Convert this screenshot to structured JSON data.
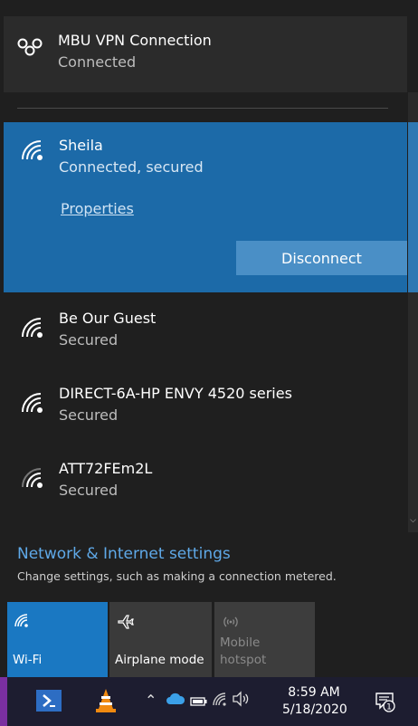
{
  "vpn": {
    "name": "MBU VPN Connection",
    "status": "Connected"
  },
  "selected_network": {
    "name": "Sheila",
    "status": "Connected, secured",
    "properties_label": "Properties",
    "disconnect_label": "Disconnect"
  },
  "networks": [
    {
      "name": "Be Our Guest",
      "status": "Secured"
    },
    {
      "name": "DIRECT-6A-HP ENVY 4520 series",
      "status": "Secured"
    },
    {
      "name": "ATT72FEm2L",
      "status": "Secured"
    }
  ],
  "settings": {
    "title": "Network & Internet settings",
    "subtitle": "Change settings, such as making a connection metered."
  },
  "quick_actions": [
    {
      "label": "Wi-Fi",
      "icon": "wifi-icon",
      "active": true
    },
    {
      "label": "Airplane mode",
      "icon": "airplane-icon",
      "active": false
    },
    {
      "label_line1": "Mobile",
      "label_line2": "hotspot",
      "icon": "hotspot-icon",
      "active": false
    }
  ],
  "taskbar": {
    "time": "8:59 AM",
    "date": "5/18/2020",
    "notification_count": "1"
  },
  "colors": {
    "accent": "#1c6aa8",
    "link": "#5fa9e8",
    "panel_bg": "#1f1f1f"
  }
}
